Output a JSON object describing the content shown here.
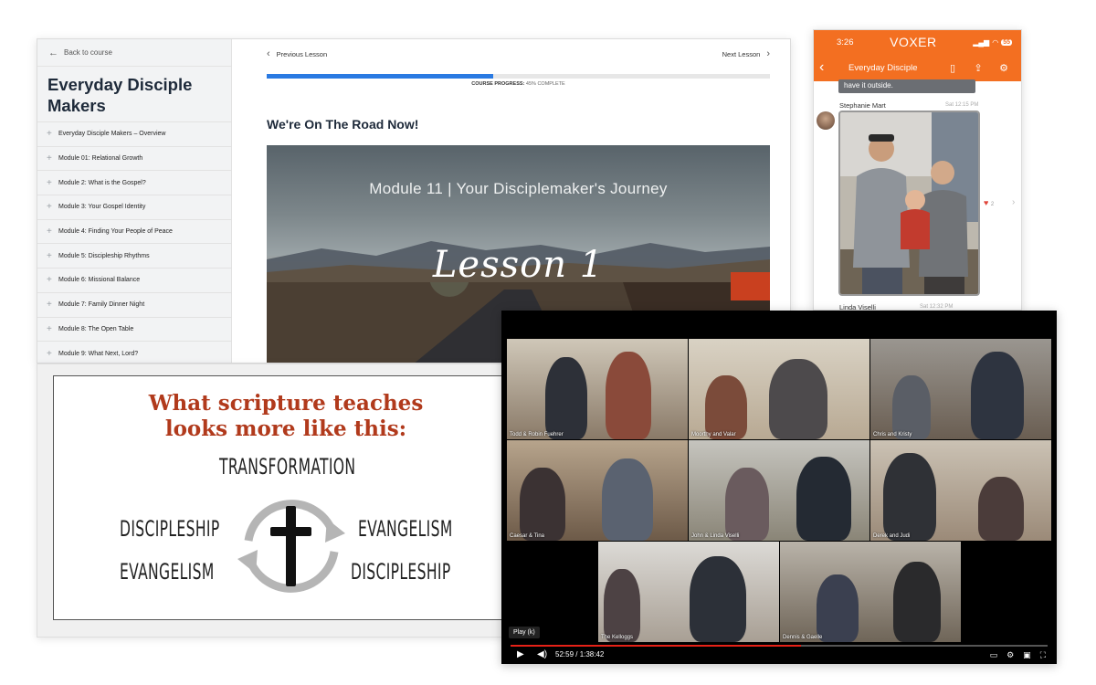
{
  "course": {
    "back_label": "Back to course",
    "title": "Everyday Disciple Makers",
    "modules": [
      "Everyday Disciple Makers – Overview",
      "Module 01: Relational Growth",
      "Module 2: What is the Gospel?",
      "Module 3: Your Gospel Identity",
      "Module 4: Finding Your People of Peace",
      "Module 5: Discipleship Rhythms",
      "Module 6: Missional Balance",
      "Module 7: Family Dinner Night",
      "Module 8: The Open Table",
      "Module 9: What Next, Lord?"
    ],
    "prev_label": "Previous Lesson",
    "next_label": "Next Lesson",
    "progress_percent": 45,
    "progress_prefix": "COURSE PROGRESS:",
    "progress_text": "45% COMPLETE",
    "lesson_title": "We're On The Road Now!",
    "video_heading": "Module 11  |  Your Disciplemaker's Journey",
    "video_script": "Lesson 1"
  },
  "voxer": {
    "time": "3:26",
    "app_name": "VOXER",
    "battery": "55",
    "chat_name": "Everyday Disciple",
    "bubble_text": "have it outside.",
    "sender": "Stephanie Mart",
    "sender_time": "Sat 12:15 PM",
    "heart_count": "2",
    "sender2": "Linda Viselli",
    "sender2_time": "Sat 12:32 PM",
    "accent": "#f36f21"
  },
  "slide": {
    "heading_line1": "What scripture teaches",
    "heading_line2": "looks more like this:",
    "top_word": "TRANSFORMATION",
    "left_top": "DISCIPLESHIP",
    "left_bottom": "EVANGELISM",
    "right_top": "EVANGELISM",
    "right_bottom": "DISCIPLESHIP",
    "heading_color": "#b13a1c"
  },
  "call": {
    "tiles": [
      "Todd & Robin Fuehrer",
      "Moorthy and Valar",
      "Chris and Kristy",
      "Caesar & Tina",
      "John & Linda Viselli",
      "Derek  and Judi",
      "The Kelloggs",
      "Dennis & Gaelle"
    ],
    "play_tooltip": "Play (k)",
    "time_text": "52:59 / 1:38:42",
    "played_fraction": 0.54
  }
}
